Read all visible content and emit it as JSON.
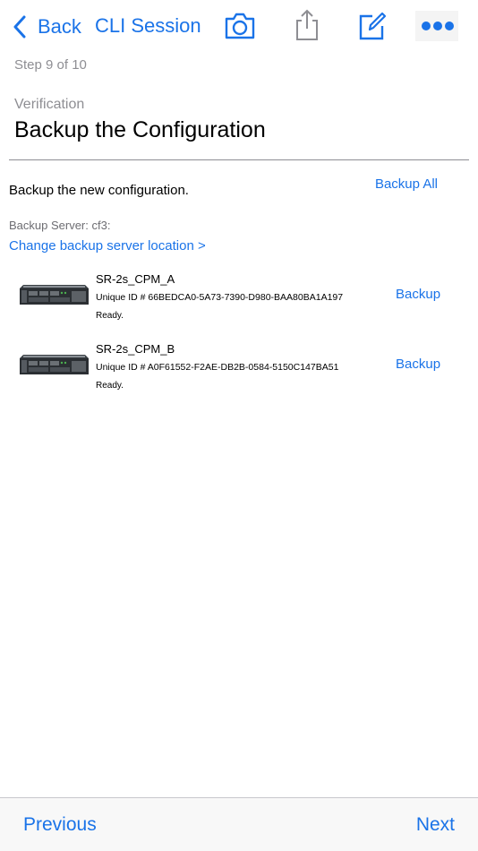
{
  "nav": {
    "back_label": "Back",
    "title": "CLI Session",
    "icons": [
      "chevron-left-icon",
      "camera-icon",
      "share-icon",
      "compose-icon",
      "more-icon"
    ]
  },
  "step": "Step 9 of 10",
  "section_label": "Verification",
  "page_title": "Backup the Configuration",
  "instruction": "Backup the new configuration.",
  "backup_all_label": "Backup All",
  "server_label": "Backup Server: cf3:",
  "change_link": "Change backup server location >",
  "devices": [
    {
      "name": "SR-2s_CPM_A",
      "unique_id": "Unique ID # 66BEDCA0-5A73-7390-D980-BAA80BA1A197",
      "status": "Ready.",
      "action": "Backup"
    },
    {
      "name": "SR-2s_CPM_B",
      "unique_id": "Unique ID # A0F61552-F2AE-DB2B-0584-5150C147BA51",
      "status": "Ready.",
      "action": "Backup"
    }
  ],
  "footer": {
    "previous": "Previous",
    "next": "Next"
  },
  "colors": {
    "accent": "#1a73e8",
    "secondary_text": "#8e8e93"
  }
}
